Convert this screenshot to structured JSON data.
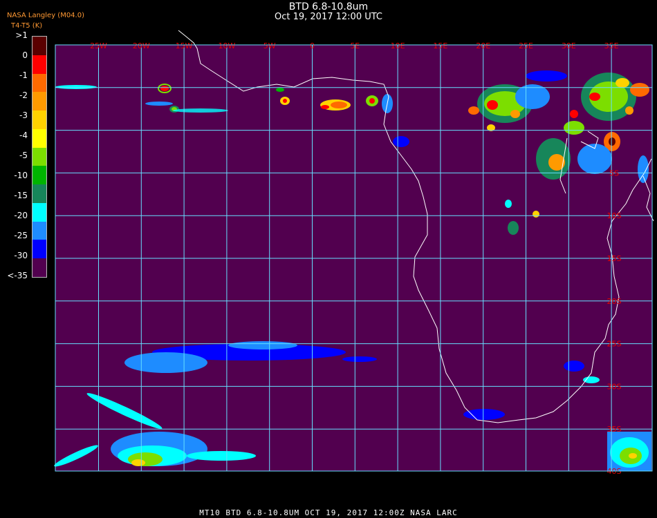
{
  "title": "BTD 6.8-10.8um",
  "subtitle": "Oct 19, 2017 12:00 UTC",
  "credit_line1": "NASA Langley (M04.0)",
  "credit_line2": "T4-T5 (K)",
  "footer": "MT10  BTD 6.8-10.8UM  OCT 19, 2017 12:00Z  NASA LARC",
  "colors": {
    "background": "#52004f",
    "grid": "#66e0ff",
    "coast": "#ffffff",
    "grid_label": "#e60000"
  },
  "legend": {
    "unit": "K",
    "items": [
      {
        "label": ">1",
        "color": "#5a0000"
      },
      {
        "label": "0",
        "color": "#ff0000"
      },
      {
        "label": "-1",
        "color": "#ff6a00"
      },
      {
        "label": "-2",
        "color": "#ff9a00"
      },
      {
        "label": "-3",
        "color": "#ffd200"
      },
      {
        "label": "-4",
        "color": "#ffff00"
      },
      {
        "label": "-5",
        "color": "#7cde00"
      },
      {
        "label": "-10",
        "color": "#00b400"
      },
      {
        "label": "-15",
        "color": "#17865a"
      },
      {
        "label": "-20",
        "color": "#00ffff"
      },
      {
        "label": "-25",
        "color": "#1e8cff"
      },
      {
        "label": "-30",
        "color": "#0000ff"
      },
      {
        "label": "<-35",
        "color": "#52004f"
      }
    ]
  },
  "grid_labels": {
    "lon": [
      "25W",
      "20W",
      "15W",
      "10W",
      "5W",
      "0",
      "5E",
      "10E",
      "15E",
      "20E",
      "25E",
      "30E",
      "35E"
    ],
    "lat": [
      "5S",
      "10S",
      "15S",
      "20S",
      "25S",
      "30S",
      "35S",
      "40S"
    ]
  }
}
